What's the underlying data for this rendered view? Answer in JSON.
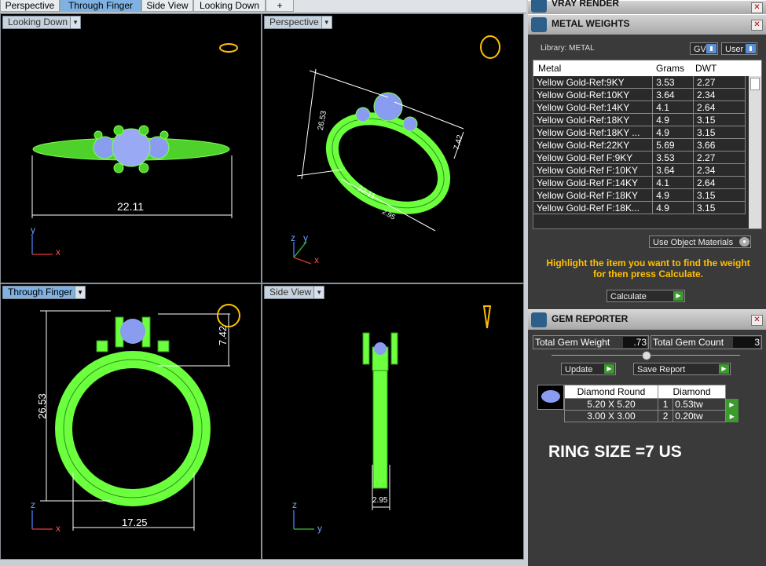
{
  "tabs": [
    "Perspective",
    "Through Finger",
    "Side View",
    "Looking Down",
    "+"
  ],
  "viewports": {
    "top_left": {
      "label": "Looking Down",
      "dimension": "22.11",
      "axis_y": "y",
      "axis_x": "x"
    },
    "top_right": {
      "label": "Perspective",
      "dimensions": [
        "26.53",
        "7.42",
        "22.11",
        "2.95"
      ],
      "axis_z": "z",
      "axis_y": "y",
      "axis_x": "x"
    },
    "bottom_left": {
      "label": "Through Finger",
      "dimensions": [
        "26.53",
        "7.42",
        "17.25"
      ],
      "axis_z": "z",
      "axis_x": "x"
    },
    "bottom_right": {
      "label": "Side View",
      "dimension": "2.95",
      "axis_z": "z",
      "axis_y": "y"
    }
  },
  "vray": {
    "title": "VRAY RENDER"
  },
  "metal_weights": {
    "title": "METAL WEIGHTS",
    "library_label": "Library: METAL",
    "gv_label": "GV",
    "user_label": "User",
    "columns": [
      "Metal",
      "Grams",
      "DWT"
    ],
    "rows": [
      [
        "Yellow Gold-Ref:9KY",
        "3.53",
        "2.27"
      ],
      [
        "Yellow Gold-Ref:10KY",
        "3.64",
        "2.34"
      ],
      [
        "Yellow Gold-Ref:14KY",
        "4.1",
        "2.64"
      ],
      [
        "Yellow Gold-Ref:18KY",
        "4.9",
        "3.15"
      ],
      [
        "Yellow Gold-Ref:18KY ...",
        "4.9",
        "3.15"
      ],
      [
        "Yellow Gold-Ref:22KY",
        "5.69",
        "3.66"
      ],
      [
        "Yellow Gold-Ref F:9KY",
        "3.53",
        "2.27"
      ],
      [
        "Yellow Gold-Ref F:10KY",
        "3.64",
        "2.34"
      ],
      [
        "Yellow Gold-Ref F:14KY",
        "4.1",
        "2.64"
      ],
      [
        "Yellow Gold-Ref F:18KY",
        "4.9",
        "3.15"
      ],
      [
        "Yellow Gold-Ref F:18K...",
        "4.9",
        "3.15"
      ]
    ],
    "use_object_materials": "Use Object Materials",
    "instruction": "Highlight the item you want to find the weight for then press Calculate.",
    "calculate_label": "Calculate"
  },
  "gem_reporter": {
    "title": "GEM REPORTER",
    "total_weight_label": "Total Gem Weight",
    "total_weight_value": ".73",
    "total_count_label": "Total Gem Count",
    "total_count_value": "3",
    "update_label": "Update",
    "save_report_label": "Save Report",
    "header": [
      "Diamond Round",
      "Diamond"
    ],
    "rows": [
      [
        "5.20 X 5.20",
        "1",
        "0.53tw"
      ],
      [
        "3.00 X 3.00",
        "2",
        "0.20tw"
      ]
    ],
    "ring_size": "RING SIZE =7 US"
  },
  "colors": {
    "wire": "#7dff52",
    "gem": "#8a9cf0",
    "accent": "#ffc000"
  }
}
